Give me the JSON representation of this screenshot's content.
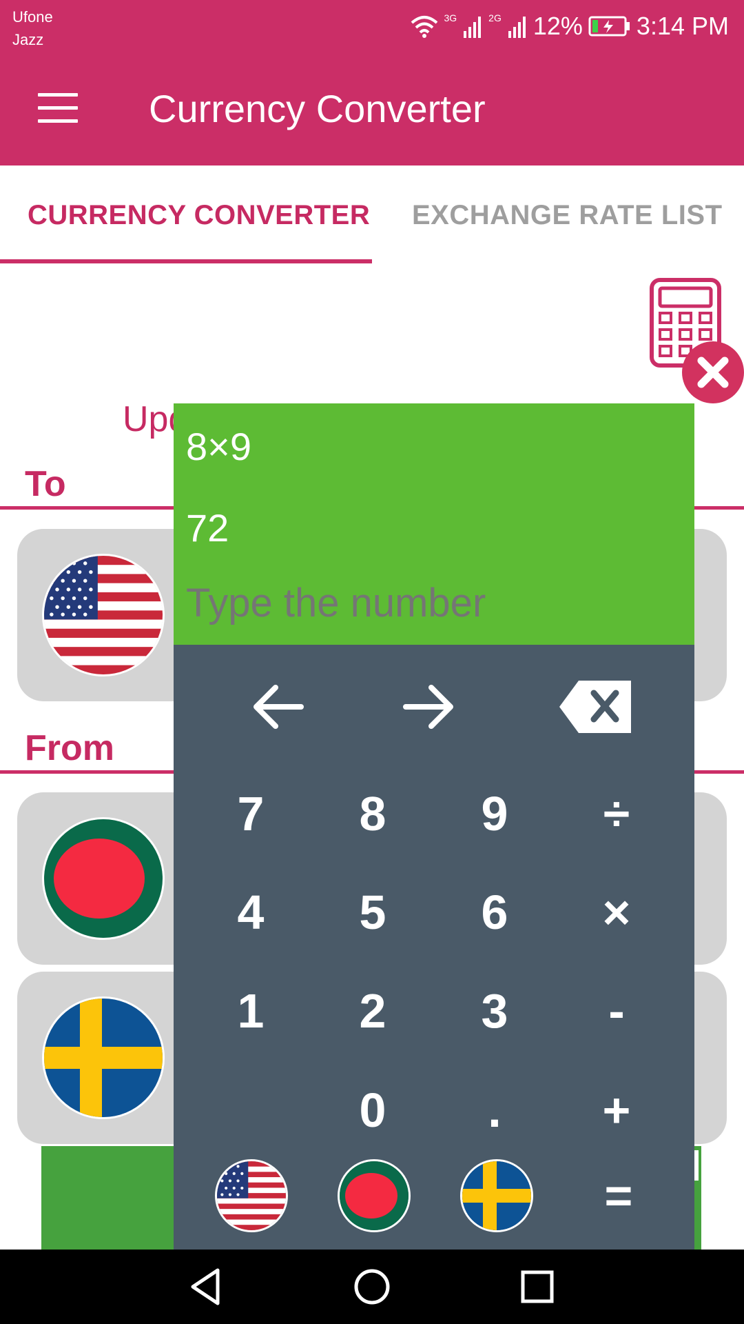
{
  "status_bar": {
    "carrier_line1": "Ufone",
    "carrier_line2": "Jazz",
    "net1": "3G",
    "net2": "2G",
    "battery": "12%",
    "time": "3:14 PM"
  },
  "app_bar": {
    "title": "Currency Converter"
  },
  "tabs": [
    {
      "label": "CURRENCY CONVERTER",
      "selected": true
    },
    {
      "label": "EXCHANGE RATE LIST",
      "selected": false
    }
  ],
  "updated_text_partial": "Upd",
  "sections": {
    "to_label": "To",
    "from_label": "From"
  },
  "calculator": {
    "expression": "8×9",
    "result": "72",
    "input_placeholder": "Type the number",
    "keys": {
      "row1": [
        "7",
        "8",
        "9",
        "÷"
      ],
      "row2": [
        "4",
        "5",
        "6",
        "×"
      ],
      "row3": [
        "1",
        "2",
        "3",
        "-"
      ],
      "row4": [
        "0",
        ".",
        "+"
      ],
      "equals": "="
    }
  },
  "colors": {
    "primary": "#cb2e67",
    "accent_text": "#c62a62",
    "calculator_display": "#5dbb34",
    "calculator_keypad": "#4a5a68",
    "card_bg": "#d4d4d4",
    "green_bar": "#46a23e"
  },
  "icons": [
    "hamburger-menu-icon",
    "calculator-icon",
    "close-icon",
    "arrow-left-icon",
    "arrow-right-icon",
    "backspace-icon",
    "flag-usa-icon",
    "flag-bangladesh-icon",
    "flag-sweden-icon",
    "nav-back-icon",
    "nav-home-icon",
    "nav-recents-icon"
  ]
}
